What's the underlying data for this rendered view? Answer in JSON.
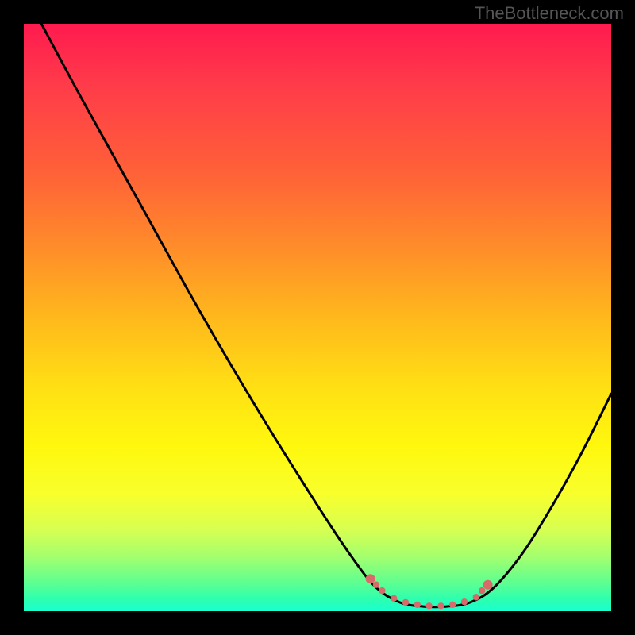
{
  "watermark": "TheBottleneck.com",
  "chart_data": {
    "type": "line",
    "title": "",
    "xlabel": "",
    "ylabel": "",
    "xlim": [
      0,
      100
    ],
    "ylim": [
      0,
      100
    ],
    "curve": [
      {
        "x": 3,
        "y": 100
      },
      {
        "x": 10,
        "y": 87
      },
      {
        "x": 20,
        "y": 69
      },
      {
        "x": 30,
        "y": 51
      },
      {
        "x": 40,
        "y": 34
      },
      {
        "x": 50,
        "y": 18
      },
      {
        "x": 56,
        "y": 9
      },
      {
        "x": 60,
        "y": 4
      },
      {
        "x": 64,
        "y": 1.5
      },
      {
        "x": 68,
        "y": 0.8
      },
      {
        "x": 72,
        "y": 0.8
      },
      {
        "x": 76,
        "y": 1.5
      },
      {
        "x": 80,
        "y": 4
      },
      {
        "x": 85,
        "y": 10
      },
      {
        "x": 90,
        "y": 18
      },
      {
        "x": 95,
        "y": 27
      },
      {
        "x": 100,
        "y": 37
      }
    ],
    "highlight_points": [
      {
        "x": 59,
        "y": 5.5
      },
      {
        "x": 60,
        "y": 4.5
      },
      {
        "x": 61,
        "y": 3.5
      },
      {
        "x": 63,
        "y": 2.2
      },
      {
        "x": 65,
        "y": 1.5
      },
      {
        "x": 67,
        "y": 1.1
      },
      {
        "x": 69,
        "y": 0.9
      },
      {
        "x": 71,
        "y": 0.9
      },
      {
        "x": 73,
        "y": 1.1
      },
      {
        "x": 75,
        "y": 1.6
      },
      {
        "x": 77,
        "y": 2.4
      },
      {
        "x": 78,
        "y": 3.5
      },
      {
        "x": 79,
        "y": 4.5
      }
    ],
    "highlight_color": "#d96a6a",
    "gradient_stops": [
      {
        "pos": 0,
        "color": "#ff1a4f"
      },
      {
        "pos": 50,
        "color": "#ffe014"
      },
      {
        "pos": 100,
        "color": "#1affd0"
      }
    ]
  }
}
